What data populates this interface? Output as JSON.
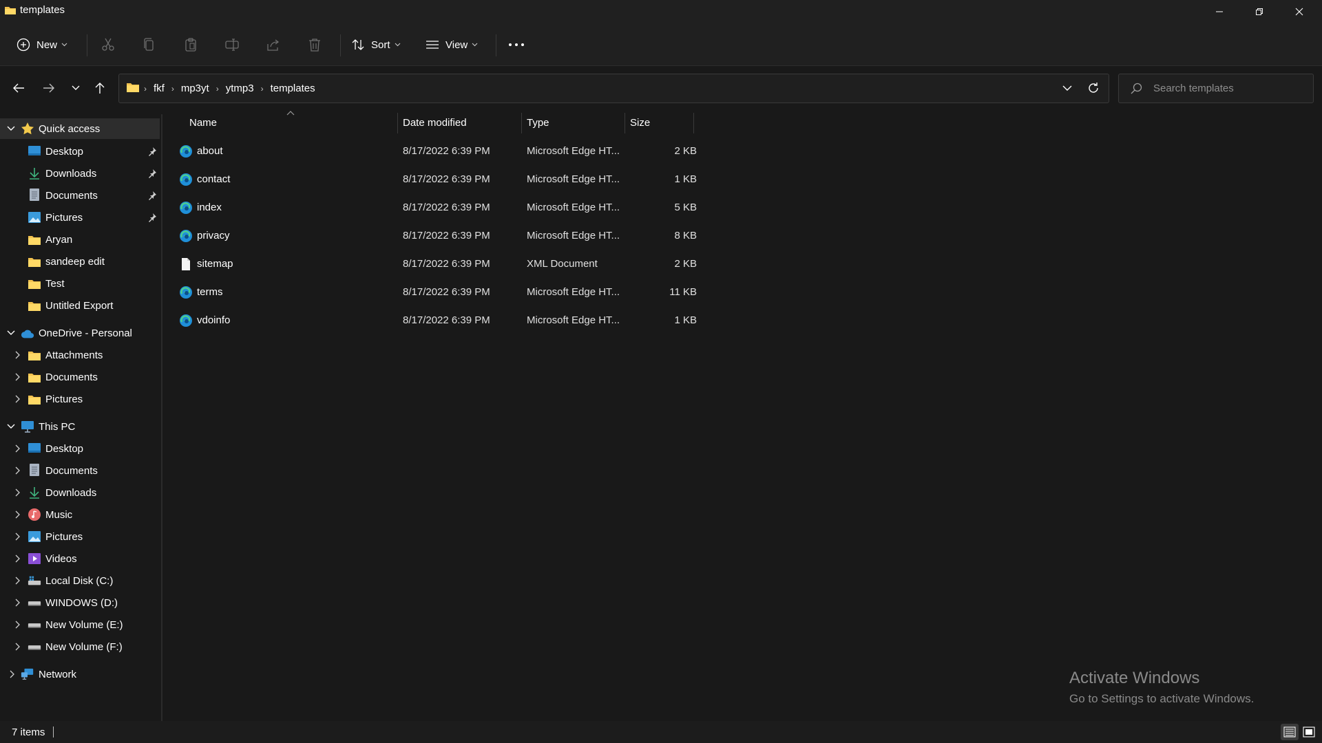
{
  "window": {
    "title": "templates"
  },
  "toolbar": {
    "new_label": "New",
    "sort_label": "Sort",
    "view_label": "View"
  },
  "breadcrumb": [
    "fkf",
    "mp3yt",
    "ytmp3",
    "templates"
  ],
  "search": {
    "placeholder": "Search templates"
  },
  "nav": {
    "quick_access": {
      "label": "Quick access",
      "items": [
        {
          "label": "Desktop",
          "icon": "desktop-icon",
          "pinned": true
        },
        {
          "label": "Downloads",
          "icon": "download-icon",
          "pinned": true
        },
        {
          "label": "Documents",
          "icon": "documents-icon",
          "pinned": true
        },
        {
          "label": "Pictures",
          "icon": "pictures-icon",
          "pinned": true
        },
        {
          "label": "Aryan",
          "icon": "folder-icon",
          "pinned": false
        },
        {
          "label": "sandeep edit",
          "icon": "folder-icon",
          "pinned": false
        },
        {
          "label": "Test",
          "icon": "folder-icon",
          "pinned": false
        },
        {
          "label": "Untitled Export",
          "icon": "folder-icon",
          "pinned": false
        }
      ]
    },
    "onedrive": {
      "label": "OneDrive - Personal",
      "items": [
        {
          "label": "Attachments",
          "icon": "folder-icon"
        },
        {
          "label": "Documents",
          "icon": "folder-icon"
        },
        {
          "label": "Pictures",
          "icon": "folder-icon"
        }
      ]
    },
    "this_pc": {
      "label": "This PC",
      "items": [
        {
          "label": "Desktop",
          "icon": "desktop-icon"
        },
        {
          "label": "Documents",
          "icon": "documents-icon"
        },
        {
          "label": "Downloads",
          "icon": "download-icon"
        },
        {
          "label": "Music",
          "icon": "music-icon"
        },
        {
          "label": "Pictures",
          "icon": "pictures-icon"
        },
        {
          "label": "Videos",
          "icon": "videos-icon"
        },
        {
          "label": "Local Disk (C:)",
          "icon": "system-drive-icon"
        },
        {
          "label": "WINDOWS (D:)",
          "icon": "drive-icon"
        },
        {
          "label": "New Volume (E:)",
          "icon": "drive-icon"
        },
        {
          "label": "New Volume (F:)",
          "icon": "drive-icon"
        }
      ]
    },
    "network": {
      "label": "Network"
    }
  },
  "columns": {
    "name": "Name",
    "date": "Date modified",
    "type": "Type",
    "size": "Size"
  },
  "files": [
    {
      "name": "about",
      "date": "8/17/2022 6:39 PM",
      "type": "Microsoft Edge HT...",
      "size": "2 KB",
      "icon": "edge-icon"
    },
    {
      "name": "contact",
      "date": "8/17/2022 6:39 PM",
      "type": "Microsoft Edge HT...",
      "size": "1 KB",
      "icon": "edge-icon"
    },
    {
      "name": "index",
      "date": "8/17/2022 6:39 PM",
      "type": "Microsoft Edge HT...",
      "size": "5 KB",
      "icon": "edge-icon"
    },
    {
      "name": "privacy",
      "date": "8/17/2022 6:39 PM",
      "type": "Microsoft Edge HT...",
      "size": "8 KB",
      "icon": "edge-icon"
    },
    {
      "name": "sitemap",
      "date": "8/17/2022 6:39 PM",
      "type": "XML Document",
      "size": "2 KB",
      "icon": "document-icon"
    },
    {
      "name": "terms",
      "date": "8/17/2022 6:39 PM",
      "type": "Microsoft Edge HT...",
      "size": "11 KB",
      "icon": "edge-icon"
    },
    {
      "name": "vdoinfo",
      "date": "8/17/2022 6:39 PM",
      "type": "Microsoft Edge HT...",
      "size": "1 KB",
      "icon": "edge-icon"
    }
  ],
  "status": {
    "item_count": "7 items"
  },
  "watermark": {
    "line1": "Activate Windows",
    "line2": "Go to Settings to activate Windows."
  },
  "colors": {
    "folder": "#f2c24f",
    "accent": "#3a9bdc",
    "background": "#191919"
  }
}
